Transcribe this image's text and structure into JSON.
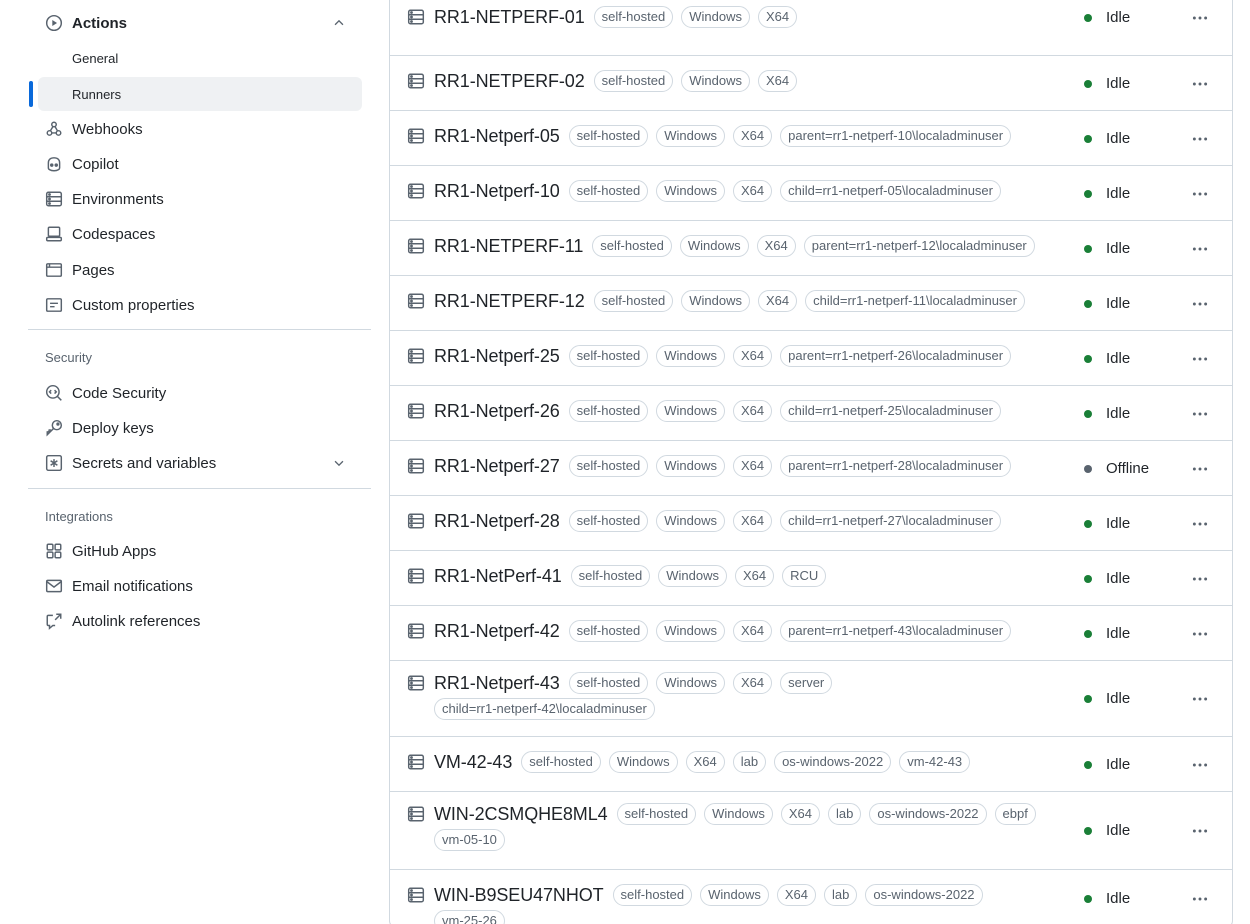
{
  "sidebar": {
    "actions_label": "Actions",
    "general_label": "General",
    "runners_label": "Runners",
    "webhooks_label": "Webhooks",
    "copilot_label": "Copilot",
    "environments_label": "Environments",
    "codespaces_label": "Codespaces",
    "pages_label": "Pages",
    "custom_properties_label": "Custom properties",
    "security_heading": "Security",
    "code_security_label": "Code Security",
    "deploy_keys_label": "Deploy keys",
    "secrets_label": "Secrets and variables",
    "integrations_heading": "Integrations",
    "github_apps_label": "GitHub Apps",
    "email_notifications_label": "Email notifications",
    "autolink_label": "Autolink references"
  },
  "colors": {
    "idle": "#1a7f37",
    "offline": "#59636e",
    "accent": "#0969da"
  },
  "runners": [
    {
      "name": "RR1-NETPERF-01",
      "labels": [
        "self-hosted",
        "Windows",
        "X64"
      ],
      "status": "Idle",
      "state": "idle"
    },
    {
      "name": "RR1-NETPERF-02",
      "labels": [
        "self-hosted",
        "Windows",
        "X64"
      ],
      "status": "Idle",
      "state": "idle"
    },
    {
      "name": "RR1-Netperf-05",
      "labels": [
        "self-hosted",
        "Windows",
        "X64",
        "parent=rr1-netperf-10\\localadminuser"
      ],
      "status": "Idle",
      "state": "idle"
    },
    {
      "name": "RR1-Netperf-10",
      "labels": [
        "self-hosted",
        "Windows",
        "X64",
        "child=rr1-netperf-05\\localadminuser"
      ],
      "status": "Idle",
      "state": "idle"
    },
    {
      "name": "RR1-NETPERF-11",
      "labels": [
        "self-hosted",
        "Windows",
        "X64",
        "parent=rr1-netperf-12\\localadminuser"
      ],
      "status": "Idle",
      "state": "idle"
    },
    {
      "name": "RR1-NETPERF-12",
      "labels": [
        "self-hosted",
        "Windows",
        "X64",
        "child=rr1-netperf-11\\localadminuser"
      ],
      "status": "Idle",
      "state": "idle"
    },
    {
      "name": "RR1-Netperf-25",
      "labels": [
        "self-hosted",
        "Windows",
        "X64",
        "parent=rr1-netperf-26\\localadminuser"
      ],
      "status": "Idle",
      "state": "idle"
    },
    {
      "name": "RR1-Netperf-26",
      "labels": [
        "self-hosted",
        "Windows",
        "X64",
        "child=rr1-netperf-25\\localadminuser"
      ],
      "status": "Idle",
      "state": "idle"
    },
    {
      "name": "RR1-Netperf-27",
      "labels": [
        "self-hosted",
        "Windows",
        "X64",
        "parent=rr1-netperf-28\\localadminuser"
      ],
      "status": "Offline",
      "state": "offline"
    },
    {
      "name": "RR1-Netperf-28",
      "labels": [
        "self-hosted",
        "Windows",
        "X64",
        "child=rr1-netperf-27\\localadminuser"
      ],
      "status": "Idle",
      "state": "idle"
    },
    {
      "name": "RR1-NetPerf-41",
      "labels": [
        "self-hosted",
        "Windows",
        "X64",
        "RCU"
      ],
      "status": "Idle",
      "state": "idle"
    },
    {
      "name": "RR1-Netperf-42",
      "labels": [
        "self-hosted",
        "Windows",
        "X64",
        "parent=rr1-netperf-43\\localadminuser"
      ],
      "status": "Idle",
      "state": "idle"
    },
    {
      "name": "RR1-Netperf-43",
      "labels": [
        "self-hosted",
        "Windows",
        "X64",
        "server",
        "child=rr1-netperf-42\\localadminuser"
      ],
      "status": "Idle",
      "state": "idle"
    },
    {
      "name": "VM-42-43",
      "labels": [
        "self-hosted",
        "Windows",
        "X64",
        "lab",
        "os-windows-2022",
        "vm-42-43"
      ],
      "status": "Idle",
      "state": "idle"
    },
    {
      "name": "WIN-2CSMQHE8ML4",
      "labels": [
        "self-hosted",
        "Windows",
        "X64",
        "lab",
        "os-windows-2022",
        "ebpf",
        "vm-05-10"
      ],
      "status": "Idle",
      "state": "idle"
    },
    {
      "name": "WIN-B9SEU47NHOT",
      "labels": [
        "self-hosted",
        "Windows",
        "X64",
        "lab",
        "os-windows-2022",
        "vm-25-26"
      ],
      "status": "Idle",
      "state": "idle"
    }
  ]
}
